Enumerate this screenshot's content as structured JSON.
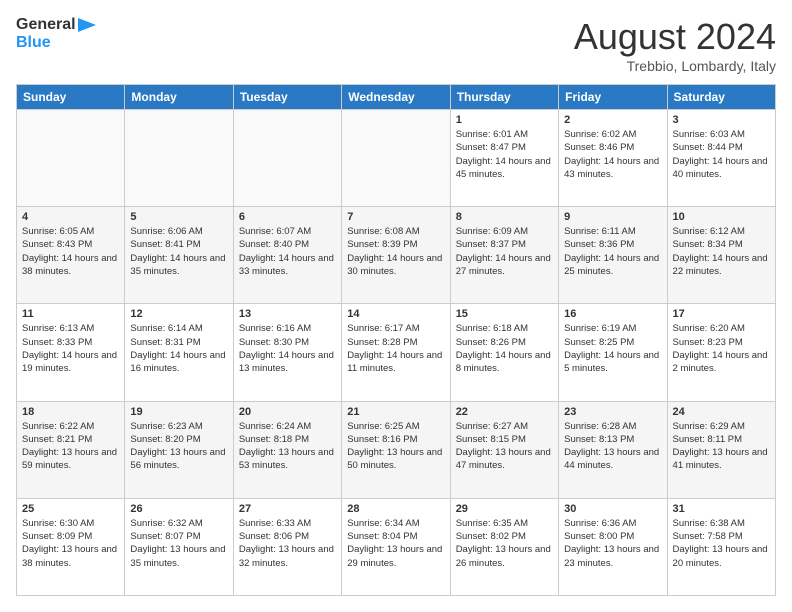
{
  "header": {
    "logo_general": "General",
    "logo_blue": "Blue",
    "month_title": "August 2024",
    "location": "Trebbio, Lombardy, Italy"
  },
  "days_of_week": [
    "Sunday",
    "Monday",
    "Tuesday",
    "Wednesday",
    "Thursday",
    "Friday",
    "Saturday"
  ],
  "weeks": [
    [
      {
        "day": "",
        "info": ""
      },
      {
        "day": "",
        "info": ""
      },
      {
        "day": "",
        "info": ""
      },
      {
        "day": "",
        "info": ""
      },
      {
        "day": "1",
        "info": "Sunrise: 6:01 AM\nSunset: 8:47 PM\nDaylight: 14 hours and 45 minutes."
      },
      {
        "day": "2",
        "info": "Sunrise: 6:02 AM\nSunset: 8:46 PM\nDaylight: 14 hours and 43 minutes."
      },
      {
        "day": "3",
        "info": "Sunrise: 6:03 AM\nSunset: 8:44 PM\nDaylight: 14 hours and 40 minutes."
      }
    ],
    [
      {
        "day": "4",
        "info": "Sunrise: 6:05 AM\nSunset: 8:43 PM\nDaylight: 14 hours and 38 minutes."
      },
      {
        "day": "5",
        "info": "Sunrise: 6:06 AM\nSunset: 8:41 PM\nDaylight: 14 hours and 35 minutes."
      },
      {
        "day": "6",
        "info": "Sunrise: 6:07 AM\nSunset: 8:40 PM\nDaylight: 14 hours and 33 minutes."
      },
      {
        "day": "7",
        "info": "Sunrise: 6:08 AM\nSunset: 8:39 PM\nDaylight: 14 hours and 30 minutes."
      },
      {
        "day": "8",
        "info": "Sunrise: 6:09 AM\nSunset: 8:37 PM\nDaylight: 14 hours and 27 minutes."
      },
      {
        "day": "9",
        "info": "Sunrise: 6:11 AM\nSunset: 8:36 PM\nDaylight: 14 hours and 25 minutes."
      },
      {
        "day": "10",
        "info": "Sunrise: 6:12 AM\nSunset: 8:34 PM\nDaylight: 14 hours and 22 minutes."
      }
    ],
    [
      {
        "day": "11",
        "info": "Sunrise: 6:13 AM\nSunset: 8:33 PM\nDaylight: 14 hours and 19 minutes."
      },
      {
        "day": "12",
        "info": "Sunrise: 6:14 AM\nSunset: 8:31 PM\nDaylight: 14 hours and 16 minutes."
      },
      {
        "day": "13",
        "info": "Sunrise: 6:16 AM\nSunset: 8:30 PM\nDaylight: 14 hours and 13 minutes."
      },
      {
        "day": "14",
        "info": "Sunrise: 6:17 AM\nSunset: 8:28 PM\nDaylight: 14 hours and 11 minutes."
      },
      {
        "day": "15",
        "info": "Sunrise: 6:18 AM\nSunset: 8:26 PM\nDaylight: 14 hours and 8 minutes."
      },
      {
        "day": "16",
        "info": "Sunrise: 6:19 AM\nSunset: 8:25 PM\nDaylight: 14 hours and 5 minutes."
      },
      {
        "day": "17",
        "info": "Sunrise: 6:20 AM\nSunset: 8:23 PM\nDaylight: 14 hours and 2 minutes."
      }
    ],
    [
      {
        "day": "18",
        "info": "Sunrise: 6:22 AM\nSunset: 8:21 PM\nDaylight: 13 hours and 59 minutes."
      },
      {
        "day": "19",
        "info": "Sunrise: 6:23 AM\nSunset: 8:20 PM\nDaylight: 13 hours and 56 minutes."
      },
      {
        "day": "20",
        "info": "Sunrise: 6:24 AM\nSunset: 8:18 PM\nDaylight: 13 hours and 53 minutes."
      },
      {
        "day": "21",
        "info": "Sunrise: 6:25 AM\nSunset: 8:16 PM\nDaylight: 13 hours and 50 minutes."
      },
      {
        "day": "22",
        "info": "Sunrise: 6:27 AM\nSunset: 8:15 PM\nDaylight: 13 hours and 47 minutes."
      },
      {
        "day": "23",
        "info": "Sunrise: 6:28 AM\nSunset: 8:13 PM\nDaylight: 13 hours and 44 minutes."
      },
      {
        "day": "24",
        "info": "Sunrise: 6:29 AM\nSunset: 8:11 PM\nDaylight: 13 hours and 41 minutes."
      }
    ],
    [
      {
        "day": "25",
        "info": "Sunrise: 6:30 AM\nSunset: 8:09 PM\nDaylight: 13 hours and 38 minutes."
      },
      {
        "day": "26",
        "info": "Sunrise: 6:32 AM\nSunset: 8:07 PM\nDaylight: 13 hours and 35 minutes."
      },
      {
        "day": "27",
        "info": "Sunrise: 6:33 AM\nSunset: 8:06 PM\nDaylight: 13 hours and 32 minutes."
      },
      {
        "day": "28",
        "info": "Sunrise: 6:34 AM\nSunset: 8:04 PM\nDaylight: 13 hours and 29 minutes."
      },
      {
        "day": "29",
        "info": "Sunrise: 6:35 AM\nSunset: 8:02 PM\nDaylight: 13 hours and 26 minutes."
      },
      {
        "day": "30",
        "info": "Sunrise: 6:36 AM\nSunset: 8:00 PM\nDaylight: 13 hours and 23 minutes."
      },
      {
        "day": "31",
        "info": "Sunrise: 6:38 AM\nSunset: 7:58 PM\nDaylight: 13 hours and 20 minutes."
      }
    ]
  ]
}
